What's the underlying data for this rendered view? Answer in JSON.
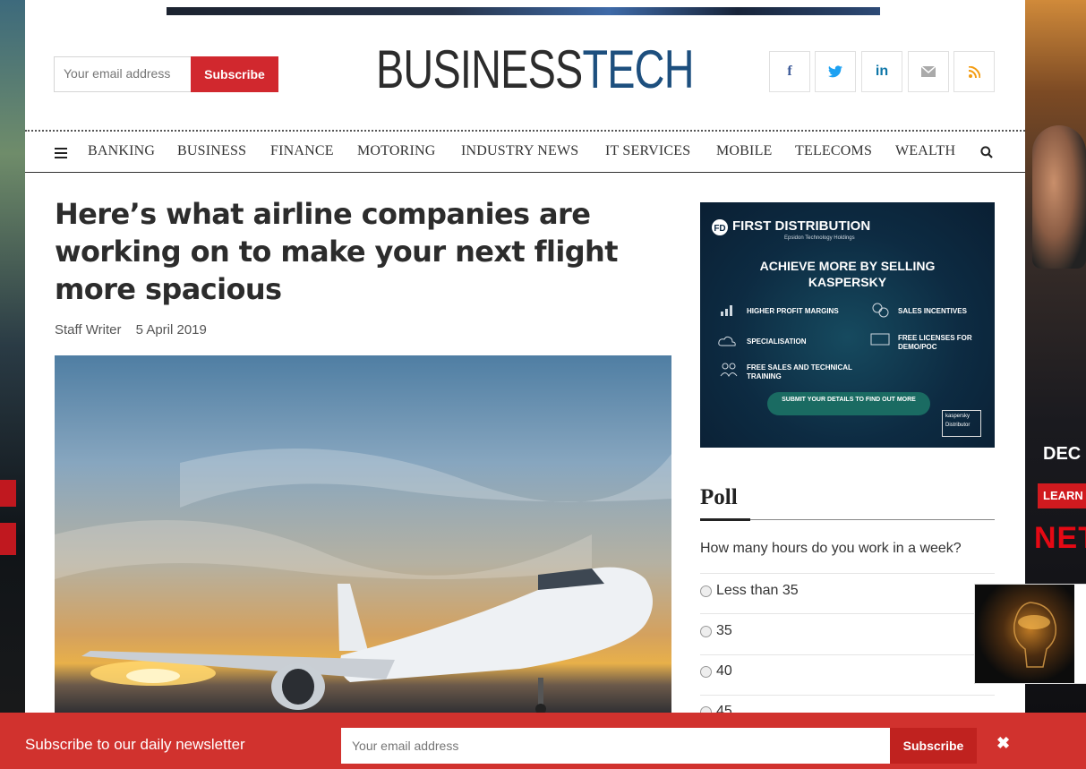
{
  "header": {
    "email_placeholder": "Your email address",
    "subscribe_label": "Subscribe",
    "logo_part1": "BUSINESS",
    "logo_part2": "TECH",
    "social": [
      {
        "icon": "facebook-icon",
        "glyph": "f",
        "color": "#3b5998"
      },
      {
        "icon": "twitter-icon",
        "glyph": "🐦",
        "color": "#1da1f2"
      },
      {
        "icon": "linkedin-icon",
        "glyph": "in",
        "color": "#0e76a8"
      },
      {
        "icon": "email-icon",
        "glyph": "✉",
        "color": "#999999"
      },
      {
        "icon": "rss-icon",
        "glyph": "⨀",
        "color": "#f39c12"
      }
    ]
  },
  "nav": {
    "items": [
      "BANKING",
      "BUSINESS",
      "FINANCE",
      "MOTORING",
      "INDUSTRY NEWS",
      "IT SERVICES",
      "MOBILE",
      "TELECOMS",
      "WEALTH"
    ]
  },
  "article": {
    "headline": "Here’s what airline companies are working on to make your next flight more spacious",
    "author": "Staff Writer",
    "date": "5 April 2019"
  },
  "ad": {
    "brand": "FIRST DISTRIBUTION",
    "sub_brand": "Epsidon Technology Holdings",
    "headline_line1": "ACHIEVE MORE BY SELLING",
    "headline_line2": "KASPERSKY",
    "features": [
      "HIGHER PROFIT MARGINS",
      "SALES INCENTIVES",
      "SPECIALISATION",
      "FREE LICENSES FOR DEMO/POC",
      "FREE SALES AND TECHNICAL TRAINING"
    ],
    "cta": "SUBMIT YOUR DETAILS TO FIND OUT MORE",
    "badge_line1": "kaspersky",
    "badge_line2": "Distributor"
  },
  "poll": {
    "title": "Poll",
    "question": "How many hours do you work in a week?",
    "options": [
      "Less than 35",
      "35",
      "40",
      "45"
    ]
  },
  "right_skin": {
    "dec": "DEC",
    "learn": "LEARN",
    "netflix": "NET"
  },
  "newsletter": {
    "text": "Subscribe to our daily newsletter",
    "placeholder": "Your email address",
    "subscribe_label": "Subscribe",
    "close": "✖"
  }
}
